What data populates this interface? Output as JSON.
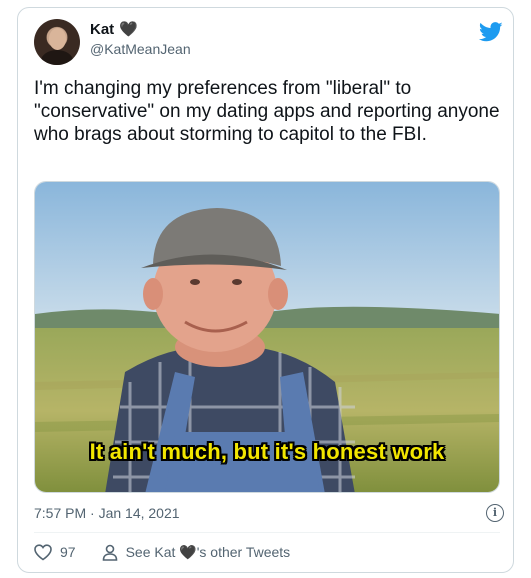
{
  "tweet": {
    "display_name": "Kat",
    "name_emoji": "🖤",
    "handle": "@KatMeanJean",
    "text": "I'm changing my preferences from \"liberal\" to \"conservative\" on my dating apps and reporting anyone who brags about storming to capitol to the FBI.",
    "meme_caption": "It ain't much, but it's honest work",
    "timestamp": "7:57 PM · Jan 14, 2021"
  },
  "actions": {
    "like_count": "97",
    "see_tweets_prefix": "See Kat ",
    "see_tweets_emoji": "🖤",
    "see_tweets_suffix": "'s other Tweets"
  },
  "icons": {
    "brand": "twitter-bird-icon",
    "like": "heart-outline-icon",
    "profile": "person-icon",
    "info": "info-icon"
  },
  "colors": {
    "brand": "#1d9bf0",
    "text_primary": "#0f1419",
    "text_secondary": "#536471",
    "border": "#cfd9de",
    "caption_yellow": "#f2e600"
  }
}
